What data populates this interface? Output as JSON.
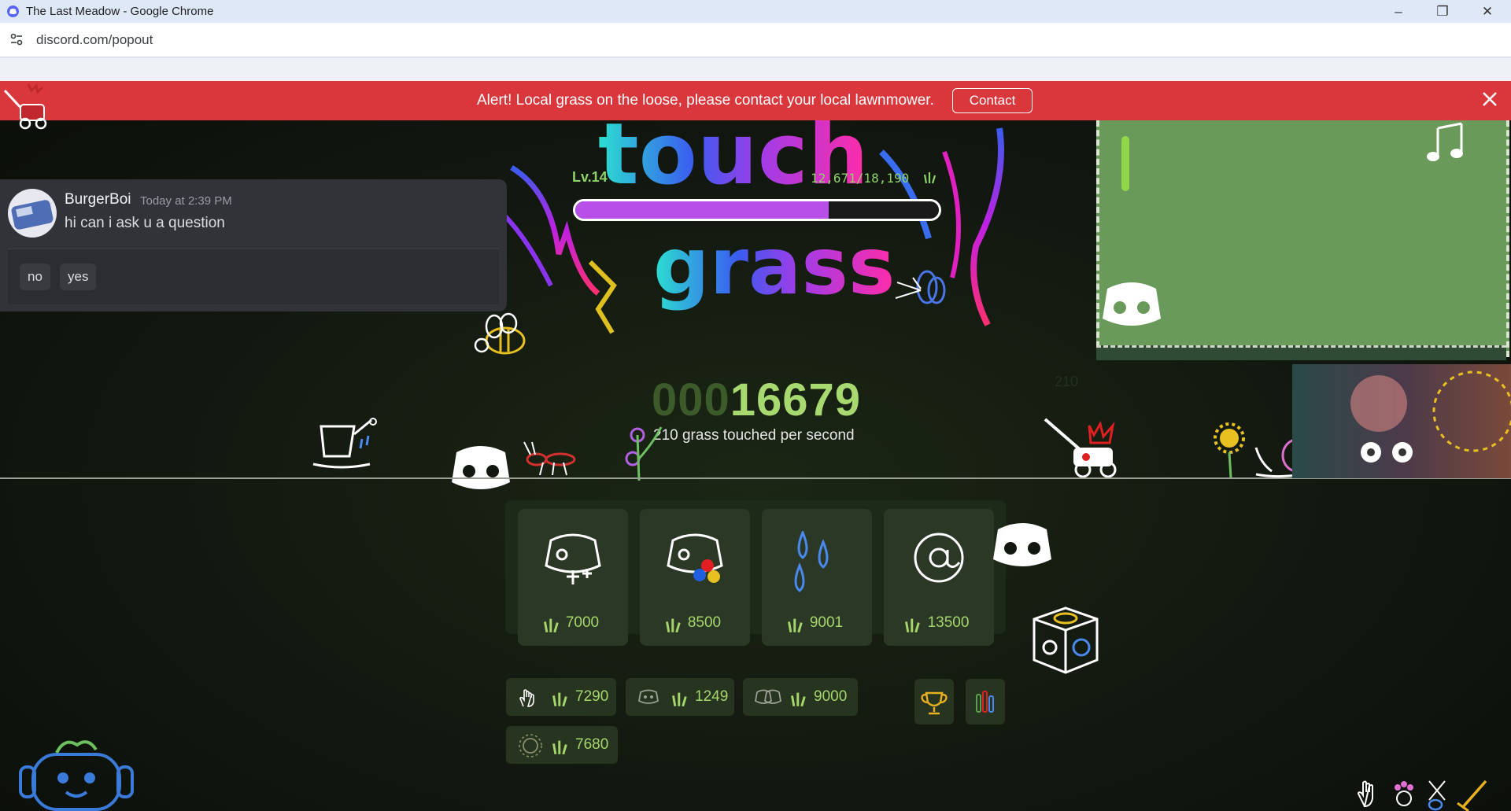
{
  "window": {
    "title": "The Last Meadow - Google Chrome",
    "url": "discord.com/popout",
    "controls": [
      "minimize",
      "restore",
      "close"
    ]
  },
  "alert": {
    "message": "Alert! Local grass on the loose, please contact your local lawnmower.",
    "contact_label": "Contact"
  },
  "player": {
    "level": "Lv.14",
    "xp": "12,671/18,190",
    "xp_progress": 0.697
  },
  "message": {
    "username": "BurgerBoi",
    "timestamp": "Today at 2:39 PM",
    "text": "hi can i ask u a question",
    "replies": [
      "no",
      "yes"
    ]
  },
  "counter": {
    "leading_zeros": "000",
    "value": "16679",
    "rate_text": "210 grass touched per second"
  },
  "upgrades": [
    {
      "icon": "discord-plus-icon",
      "price": "7000"
    },
    {
      "icon": "discord-paint-icon",
      "price": "8500"
    },
    {
      "icon": "water-drops-icon",
      "price": "9001"
    },
    {
      "icon": "at-sign-icon",
      "price": "13500"
    }
  ],
  "stats": [
    {
      "icon": "hand-icon",
      "value": "7290"
    },
    {
      "icon": "discord-sprout-icon",
      "value": "1249"
    },
    {
      "icon": "discord-group-icon",
      "value": "9000"
    },
    {
      "icon": "sun-icon",
      "value": "7680"
    }
  ],
  "colors": {
    "alert": "#da373c",
    "grass_green": "#a5d66b",
    "xp_fill": "#b84fe8",
    "discord_card": "#313338"
  }
}
